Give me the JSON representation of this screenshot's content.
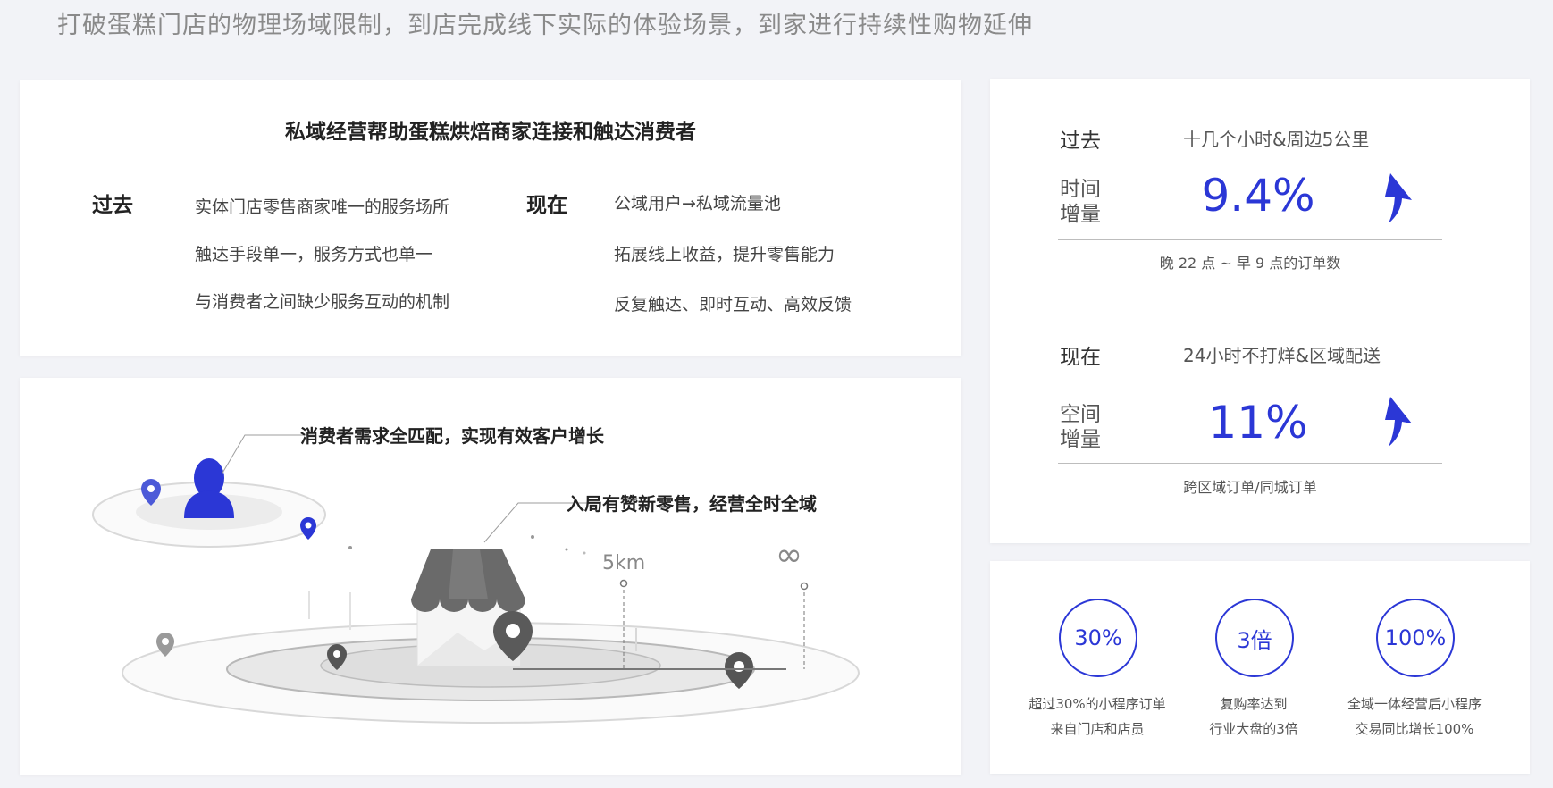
{
  "subtitle": "打破蛋糕门店的物理场域限制，到店完成线下实际的体验场景，到家进行持续性购物延伸",
  "card_a": {
    "title": "私域经营帮助蛋糕烘焙商家连接和触达消费者",
    "past": {
      "heading": "过去",
      "items": [
        "实体门店零售商家唯一的服务场所",
        "触达手段单一，服务方式也单一",
        "与消费者之间缺少服务互动的机制"
      ]
    },
    "now": {
      "heading": "现在",
      "items": [
        "公域用户→私域流量池",
        "拓展线上收益，提升零售能力",
        "反复触达、即时互动、高效反馈"
      ]
    }
  },
  "card_b": {
    "label_consumer": "消费者需求全匹配，实现有效客户增长",
    "label_store": "入局有赞新零售，经营全时全域",
    "distance": "5km",
    "infinity": "∞"
  },
  "card_c": {
    "past": {
      "heading": "过去",
      "desc": "十几个小时&周边5公里",
      "label": "时间增量",
      "value": "9.4%",
      "note": "晚 22 点 ~ 早 9 点的订单数"
    },
    "now": {
      "heading": "现在",
      "desc": "24小时不打烊&区域配送",
      "label": "空间增量",
      "value": "11%",
      "note": "跨区域订单/同城订单"
    }
  },
  "card_d": {
    "stats": [
      {
        "value": "30%",
        "line1": "超过30%的小程序订单",
        "line2": "来自门店和店员"
      },
      {
        "value": "3倍",
        "line1": "复购率达到",
        "line2": "行业大盘的3倍"
      },
      {
        "value": "100%",
        "line1": "全域一体经营后小程序",
        "line2": "交易同比增长100%"
      }
    ]
  },
  "colors": {
    "accent": "#2b37d6",
    "illustration_gray": "#6b6b6b"
  }
}
